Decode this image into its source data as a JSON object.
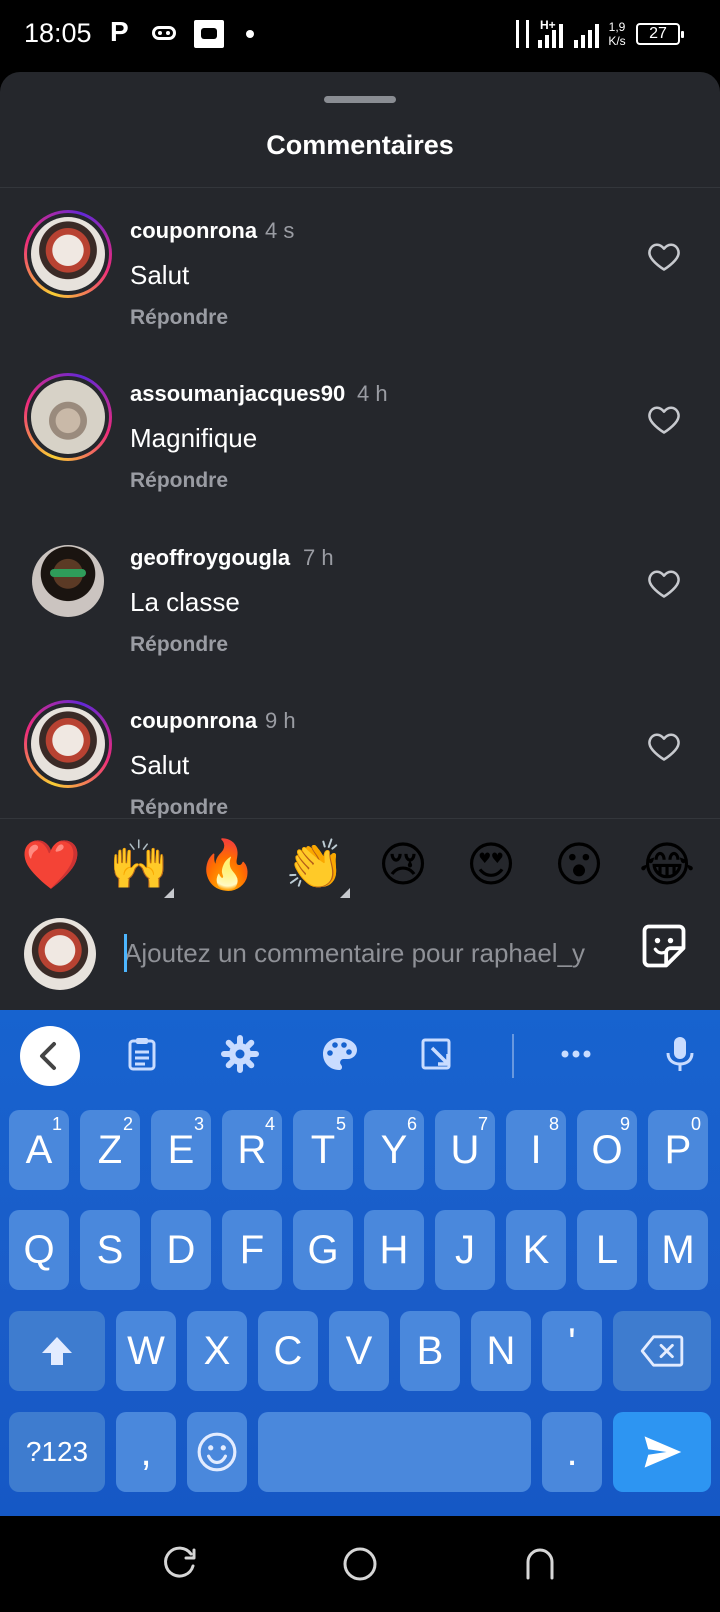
{
  "status_bar": {
    "time": "18:05",
    "p_icon": "P",
    "network": "H+",
    "speed_top": "1,9",
    "speed_bottom": "K/s",
    "battery": "27"
  },
  "sheet": {
    "title": "Commentaires"
  },
  "comments": [
    {
      "user": "couponrona",
      "time": "4 s",
      "text": "Salut",
      "reply": "Répondre"
    },
    {
      "user": "assoumanjacques90",
      "time": "4 h",
      "text": "Magnifique",
      "reply": "Répondre"
    },
    {
      "user": "geoffroygougla",
      "time": "7 h",
      "text": "La classe",
      "reply": "Répondre"
    },
    {
      "user": "couponrona",
      "time": "9 h",
      "text": "Salut",
      "reply": "Répondre"
    }
  ],
  "reactions": [
    "❤️",
    "🙌",
    "🔥",
    "👏",
    "😢",
    "😍",
    "😮",
    "😂"
  ],
  "comment_input": {
    "placeholder": "Ajoutez un commentaire pour raphael_y"
  },
  "keyboard": {
    "row1": [
      {
        "label": "A",
        "hint": "1"
      },
      {
        "label": "Z",
        "hint": "2"
      },
      {
        "label": "E",
        "hint": "3"
      },
      {
        "label": "R",
        "hint": "4"
      },
      {
        "label": "T",
        "hint": "5"
      },
      {
        "label": "Y",
        "hint": "6"
      },
      {
        "label": "U",
        "hint": "7"
      },
      {
        "label": "I",
        "hint": "8"
      },
      {
        "label": "O",
        "hint": "9"
      },
      {
        "label": "P",
        "hint": "0"
      }
    ],
    "row2": [
      "Q",
      "S",
      "D",
      "F",
      "G",
      "H",
      "J",
      "K",
      "L",
      "M"
    ],
    "row3": [
      "W",
      "X",
      "C",
      "V",
      "B",
      "N",
      "'"
    ],
    "symbols_label": "?123",
    "comma": ",",
    "period": "."
  },
  "icons": {
    "like": "heart-outline-icon",
    "sticker": "sticker-icon",
    "kb_tools": [
      "chevron-left-icon",
      "clipboard-icon",
      "gear-icon",
      "palette-icon",
      "resize-icon",
      "more-icon",
      "microphone-icon"
    ]
  }
}
